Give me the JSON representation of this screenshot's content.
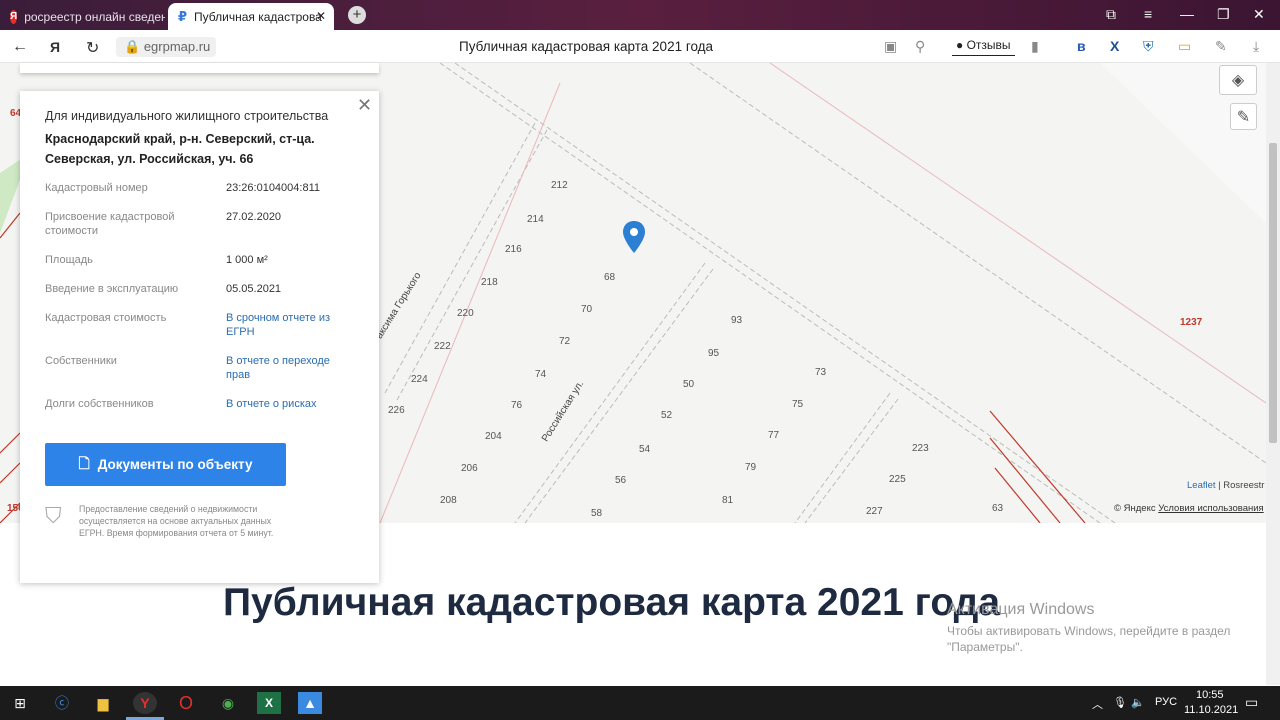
{
  "browser": {
    "tabs": [
      {
        "label": "росреестр онлайн сведен",
        "icon": "yandex-icon"
      },
      {
        "label": "Публичная кадастрова",
        "icon": "cadastral-site-icon",
        "active": true
      }
    ],
    "url": "egrpmap.ru",
    "page_title": "Публичная кадастровая карта 2021 года",
    "reviews_label": "Отзывы"
  },
  "card": {
    "type": "Для индивидуального жилищного строительства",
    "address": "Краснодарский край, р-н. Северский, ст-ца. Северская, ул. Российская, уч. 66",
    "rows": [
      {
        "key": "Кадастровый номер",
        "value": "23:26:0104004:811"
      },
      {
        "key": "Присвоение кадастровой стоимости",
        "value": "27.02.2020"
      },
      {
        "key": "Площадь",
        "value": "1 000 м²"
      },
      {
        "key": "Введение в эксплуатацию",
        "value": "05.05.2021"
      },
      {
        "key": "Кадастровая стоимость",
        "value": "В срочном отчете из ЕГРН"
      },
      {
        "key": "Собственники",
        "value": "В отчете о переходе прав"
      },
      {
        "key": "Долги собственников",
        "value": "В отчете о рисках"
      }
    ],
    "button": "Документы по объекту",
    "note": "Предоставление сведений о недвижимости осуществляется на основе актуальных данных ЕГРН. Время формирования отчета от 5 минут."
  },
  "map": {
    "parcels": [
      "212",
      "214",
      "216",
      "218",
      "220",
      "222",
      "224",
      "226",
      "204",
      "206",
      "208",
      "68",
      "70",
      "72",
      "74",
      "76",
      "93",
      "95",
      "50",
      "52",
      "54",
      "56",
      "58",
      "73",
      "75",
      "77",
      "79",
      "81",
      "223",
      "225",
      "227",
      "63"
    ],
    "red_labels": [
      "1237",
      "64",
      "150"
    ],
    "streets": [
      "Российская ул.",
      "аксима Горького"
    ],
    "attribution_leaflet": "Leaflet",
    "attribution_rosreestr": "Rosreestr",
    "attribution_yandex": "© Яндекс",
    "attribution_terms": "Условия использования"
  },
  "heading": "Публичная кадастровая карта 2021 года",
  "watermark": {
    "title": "Активация Windows",
    "text": "Чтобы активировать Windows, перейдите в раздел \"Параметры\"."
  },
  "taskbar": {
    "lang": "РУС",
    "time": "10:55",
    "date": "11.10.2021"
  }
}
